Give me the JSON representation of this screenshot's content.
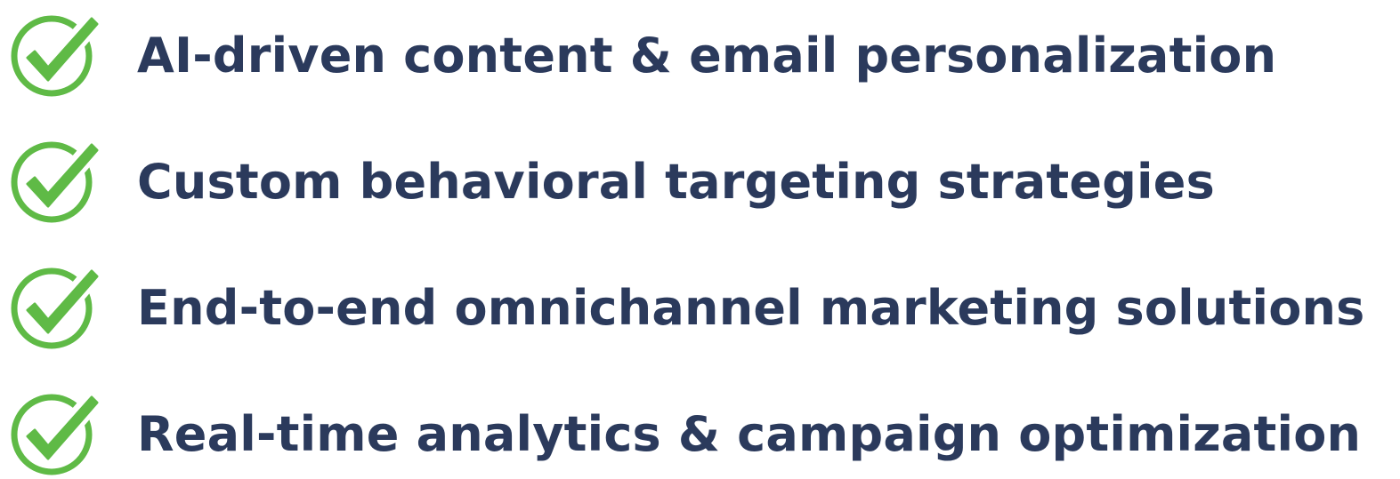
{
  "colors": {
    "text": "#2b3a5c",
    "check": "#5fba46"
  },
  "features": [
    {
      "icon": "check-circle-icon",
      "label": "AI-driven content & email personalization"
    },
    {
      "icon": "check-circle-icon",
      "label": "Custom behavioral targeting strategies"
    },
    {
      "icon": "check-circle-icon",
      "label": "End-to-end omnichannel marketing solutions"
    },
    {
      "icon": "check-circle-icon",
      "label": "Real-time analytics & campaign optimization"
    }
  ]
}
